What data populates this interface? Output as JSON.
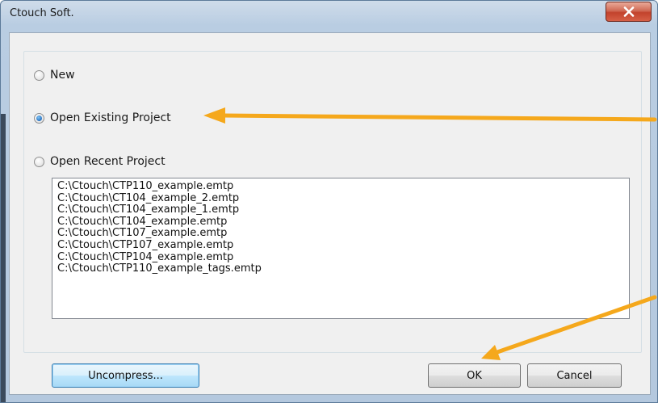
{
  "window": {
    "title": "Ctouch Soft.",
    "close_label": "x"
  },
  "options": {
    "new_label": "New",
    "open_existing_label": "Open Existing Project",
    "open_recent_label": "Open Recent Project",
    "selected": "open_existing"
  },
  "recent_projects": [
    "C:\\Ctouch\\CTP110_example.emtp",
    "C:\\Ctouch\\CT104_example_2.emtp",
    "C:\\Ctouch\\CT104_example_1.emtp",
    "C:\\Ctouch\\CT104_example.emtp",
    "C:\\Ctouch\\CT107_example.emtp",
    "C:\\Ctouch\\CTP107_example.emtp",
    "C:\\Ctouch\\CTP104_example.emtp",
    "C:\\Ctouch\\CTP110_example_tags.emtp"
  ],
  "buttons": {
    "uncompress_label": "Uncompress...",
    "ok_label": "OK",
    "cancel_label": "Cancel"
  },
  "annotations": {
    "arrow_color": "#f5a81c",
    "arrows": [
      "arrow-to-open-existing",
      "arrow-to-ok-button"
    ]
  },
  "colors": {
    "title_bar": "#b9cde2",
    "close_button": "#c2432d",
    "dialog_background": "#f0f0f0",
    "radio_selected": "#2a73c2"
  }
}
